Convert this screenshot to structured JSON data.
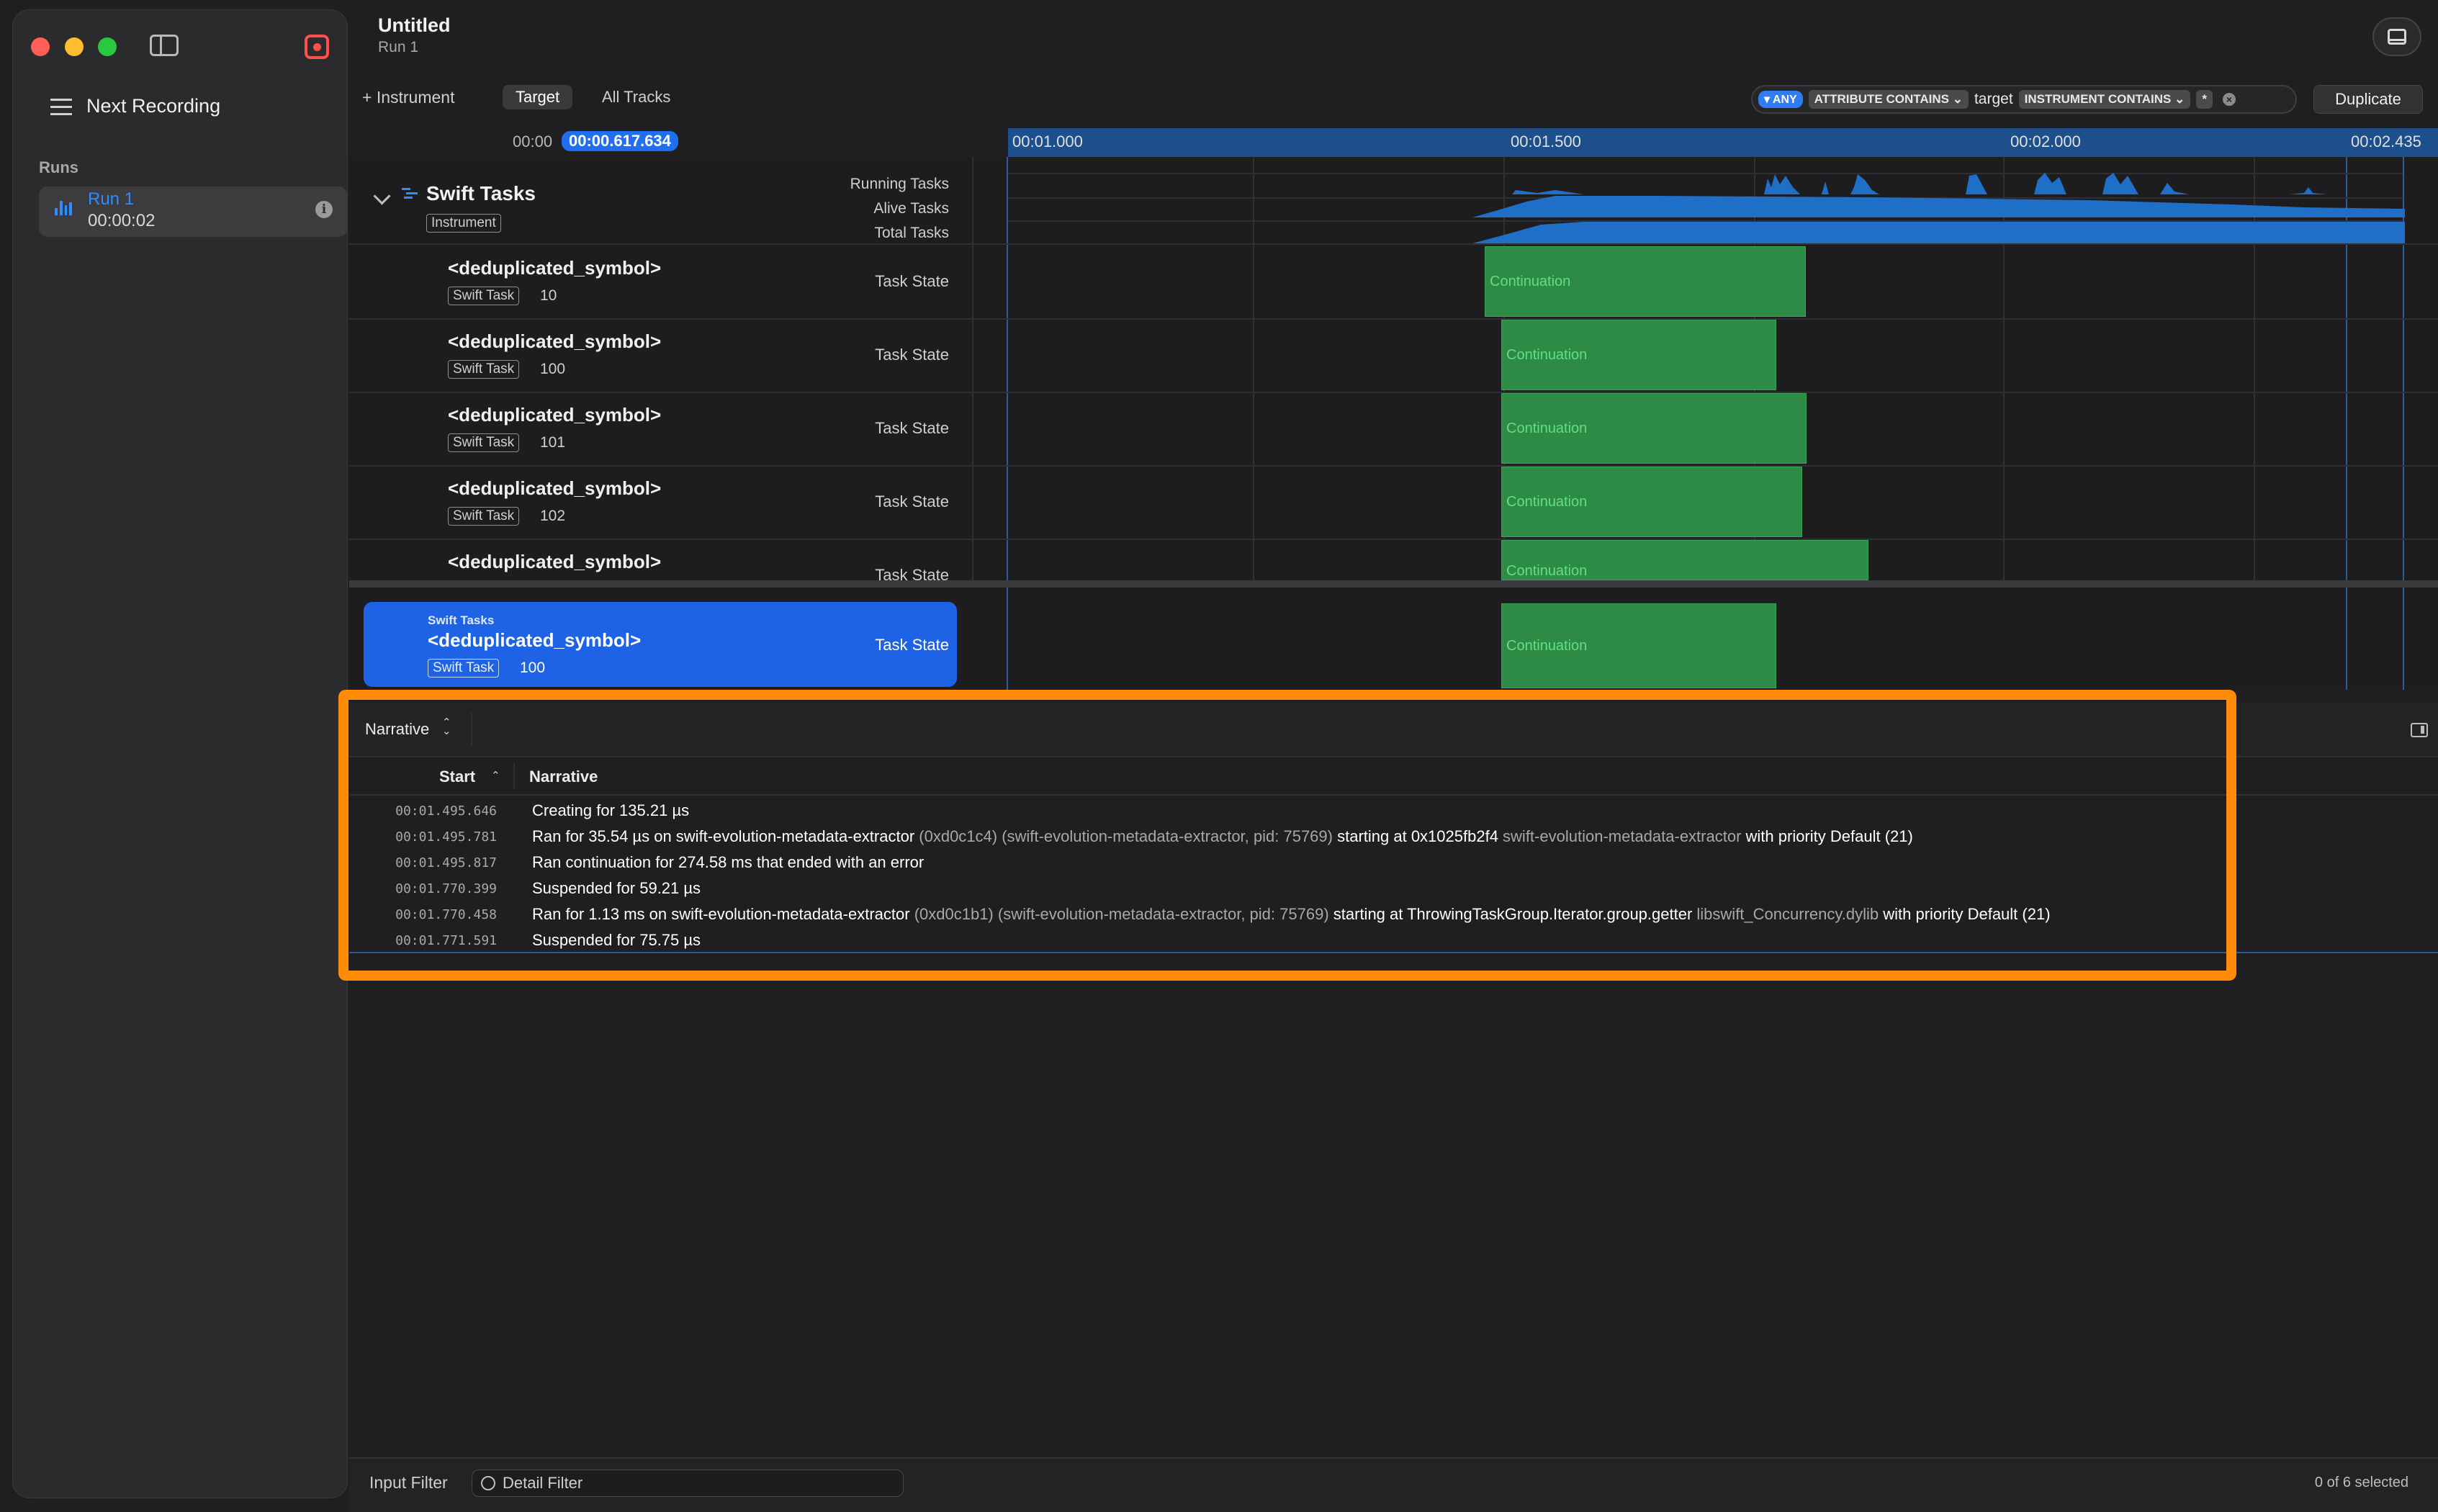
{
  "window": {
    "title": "Untitled",
    "subtitle": "Run 1"
  },
  "sidebar": {
    "next_recording": "Next Recording",
    "runs_label": "Runs",
    "run": {
      "name": "Run 1",
      "duration": "00:00:02"
    }
  },
  "toolbar": {
    "instrument_label": "+ Instrument",
    "tabs": [
      "Target",
      "All Tracks"
    ],
    "active_tab": "Target",
    "filter": {
      "any_label": "ANY",
      "condition1": "ATTRIBUTE CONTAINS",
      "value1": "target",
      "condition2": "INSTRUMENT CONTAINS",
      "value2": "*"
    },
    "duplicate_label": "Duplicate"
  },
  "timeline": {
    "start_label": "00:00",
    "cursor_time": "00:00.617.634",
    "ticks": [
      "00:01.000",
      "00:01.500",
      "00:02.000",
      "00:02.435"
    ]
  },
  "tracks": {
    "instrument": {
      "name": "Swift Tasks",
      "badge": "Instrument",
      "summary_labels": [
        "Running Tasks",
        "Alive Tasks",
        "Total Tasks"
      ]
    },
    "rows": [
      {
        "name": "<deduplicated_symbol>",
        "badge": "Swift Task",
        "id": "10",
        "state": "Task State",
        "bar_label": "Continuation"
      },
      {
        "name": "<deduplicated_symbol>",
        "badge": "Swift Task",
        "id": "100",
        "state": "Task State",
        "bar_label": "Continuation"
      },
      {
        "name": "<deduplicated_symbol>",
        "badge": "Swift Task",
        "id": "101",
        "state": "Task State",
        "bar_label": "Continuation"
      },
      {
        "name": "<deduplicated_symbol>",
        "badge": "Swift Task",
        "id": "102",
        "state": "Task State",
        "bar_label": "Continuation"
      },
      {
        "name": "<deduplicated_symbol>",
        "badge": "",
        "id": "",
        "state": "Task State",
        "bar_label": "Continuation"
      }
    ],
    "selected": {
      "group": "Swift Tasks",
      "name": "<deduplicated_symbol>",
      "badge": "Swift Task",
      "id": "100",
      "state": "Task State",
      "bar_label": "Continuation"
    }
  },
  "narrative": {
    "view_selector": "Narrative",
    "columns": [
      "Start",
      "Narrative"
    ],
    "rows": [
      {
        "start": "00:01.495.646",
        "parts": [
          {
            "t": "Creating for 135.21 µs",
            "dim": false
          }
        ]
      },
      {
        "start": "00:01.495.781",
        "parts": [
          {
            "t": "Ran for 35.54 µs on swift-evolution-metadata-extractor ",
            "dim": false
          },
          {
            "t": "(0xd0c1c4) (swift-evolution-metadata-extractor, pid: 75769) ",
            "dim": true
          },
          {
            "t": "starting at 0x1025fb2f4 ",
            "dim": false
          },
          {
            "t": " swift-evolution-metadata-extractor ",
            "dim": true
          },
          {
            "t": "with priority Default (21)",
            "dim": false
          }
        ]
      },
      {
        "start": "00:01.495.817",
        "parts": [
          {
            "t": "Ran continuation for 274.58 ms that ended with an error",
            "dim": false
          }
        ]
      },
      {
        "start": "00:01.770.399",
        "parts": [
          {
            "t": "Suspended for 59.21 µs",
            "dim": false
          }
        ]
      },
      {
        "start": "00:01.770.458",
        "parts": [
          {
            "t": "Ran for 1.13 ms on swift-evolution-metadata-extractor ",
            "dim": false
          },
          {
            "t": "(0xd0c1b1) (swift-evolution-metadata-extractor, pid: 75769) ",
            "dim": true
          },
          {
            "t": "starting at ThrowingTaskGroup.Iterator.group.getter ",
            "dim": false
          },
          {
            "t": " libswift_Concurrency.dylib ",
            "dim": true
          },
          {
            "t": "with priority Default (21)",
            "dim": false
          }
        ]
      },
      {
        "start": "00:01.771.591",
        "parts": [
          {
            "t": "Suspended for 75.75 µs",
            "dim": false
          }
        ]
      }
    ]
  },
  "bottom": {
    "input_filter": "Input Filter",
    "detail_filter_placeholder": "Detail Filter",
    "selection_count": "0 of 6 selected"
  },
  "colors": {
    "accent": "#2f7cf6",
    "continuation": "#2e8b45",
    "highlight": "#ff8b06",
    "record": "#ff4f4a"
  }
}
